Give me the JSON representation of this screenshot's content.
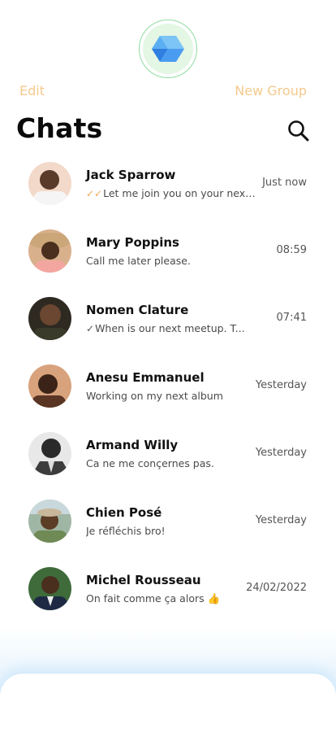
{
  "header": {
    "edit_label": "Edit",
    "new_group_label": "New Group",
    "title": "Chats",
    "accent_color": "#f5c98c",
    "logo_icon": "cube-logo-icon",
    "search_icon": "search-icon"
  },
  "chats": [
    {
      "name": "Jack Sparrow",
      "message": "Let me join you on your next...",
      "time": "Just now",
      "receipt": "double-check-orange"
    },
    {
      "name": "Mary Poppins",
      "message": "Call me later please.",
      "time": "08:59",
      "receipt": ""
    },
    {
      "name": "Nomen Clature",
      "message": "When is our next meetup. T...",
      "time": "07:41",
      "receipt": "check-grey"
    },
    {
      "name": "Anesu Emmanuel",
      "message": "Working on my next album",
      "time": "Yesterday",
      "receipt": ""
    },
    {
      "name": "Armand Willy",
      "message": "Ca ne me conçernes pas.",
      "time": "Yesterday",
      "receipt": ""
    },
    {
      "name": "Chien Posé",
      "message": "Je réfléchis bro!",
      "time": "Yesterday",
      "receipt": ""
    },
    {
      "name": "Michel Rousseau",
      "message": "On fait comme ça alors 👍",
      "time": "24/02/2022",
      "receipt": ""
    }
  ]
}
